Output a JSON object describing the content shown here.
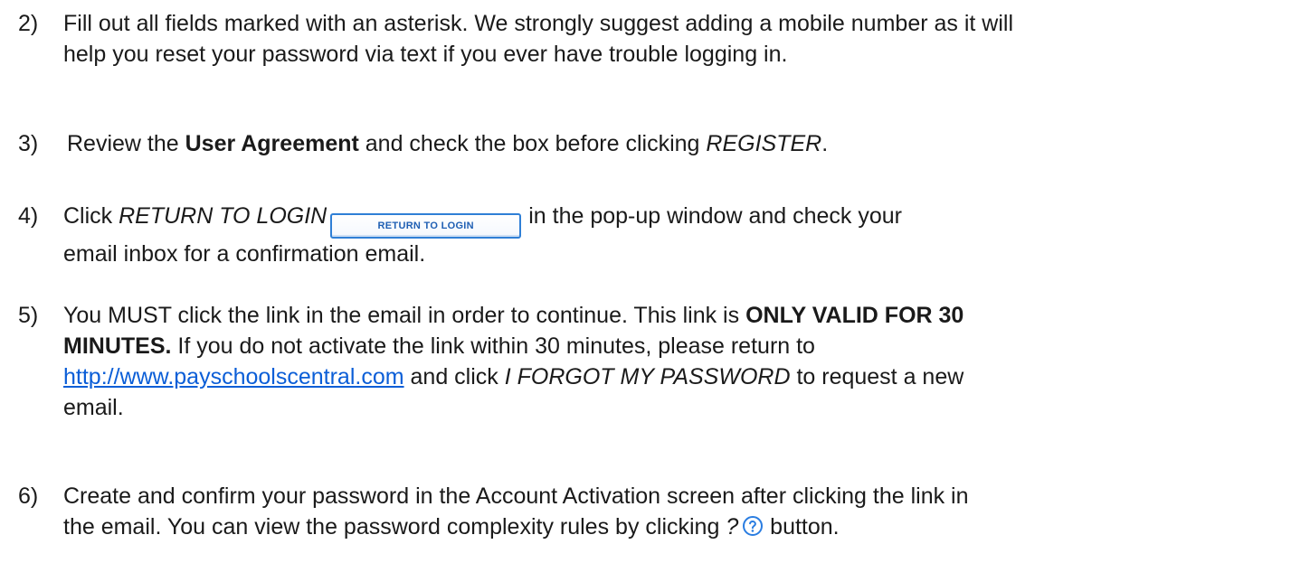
{
  "steps": [
    {
      "number": "2)",
      "lines": [
        "Fill out all fields marked with an asterisk. We strongly suggest adding a mobile number as it will",
        "help you reset your password via text if you ever have trouble logging in."
      ]
    },
    {
      "number": "3)",
      "prefix": "Review the ",
      "bold": "User Agreement",
      "middle": " and check the box before clicking ",
      "italic": "REGISTER",
      "suffix": "."
    },
    {
      "number": "4)",
      "prefix": "Click ",
      "italic": "RETURN TO LOGIN",
      "button_label": "RETURN TO LOGIN",
      "suffix": "in the pop-up window and check your",
      "line2": "email inbox for a confirmation email."
    },
    {
      "number": "5)",
      "line1_text": "You MUST click the link in the email in order to continue. This link is ",
      "line1_bold": "ONLY VALID FOR 30",
      "line2_bold": "MINUTES.",
      "line2_text": " If you do not activate the link within 30 minutes, please return to",
      "link": "http://www.payschoolscentral.com",
      "line3_middle": " and click ",
      "line3_italic": "I FORGOT MY PASSWORD",
      "line3_suffix": " to request a new",
      "line4": "email."
    },
    {
      "number": "6)",
      "line1": "Create and confirm your password in the Account Activation screen after clicking the link in",
      "line2_prefix": "the email. You can view the password complexity rules by clicking ",
      "line2_italic": "?",
      "line2_suffix": " button.",
      "icon": "question-circle-icon",
      "icon_color": "#2a7de1"
    }
  ]
}
